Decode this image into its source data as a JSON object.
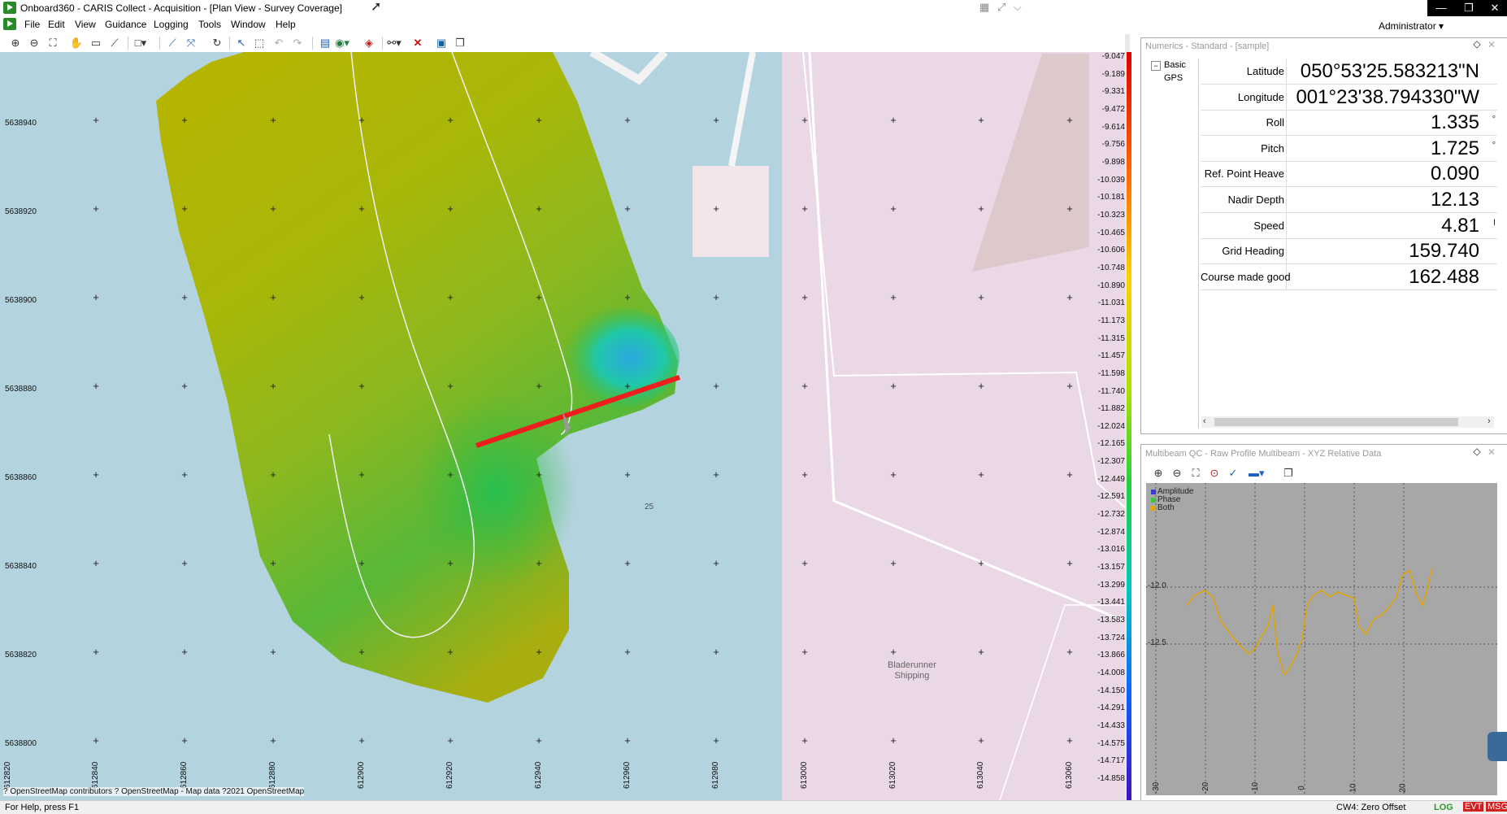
{
  "window": {
    "title": "Onboard360 - CARIS Collect - Acquisition - [Plan View - Survey Coverage]",
    "minimize_label": "—",
    "maximize_label": "❐",
    "close_label": "✕",
    "user_menu": "Administrator ▾"
  },
  "menu": {
    "items": [
      "File",
      "Edit",
      "View",
      "Guidance",
      "Logging",
      "Tools",
      "Window",
      "Help"
    ]
  },
  "plan_view": {
    "northing_labels": [
      "5638940",
      "5638920",
      "5638900",
      "5638880",
      "5638860",
      "5638840",
      "5638820",
      "5638800"
    ],
    "easting_labels": [
      "612820",
      "612840",
      "612860",
      "612880",
      "612900",
      "612920",
      "612940",
      "612960",
      "612980",
      "613000",
      "613020",
      "613040",
      "613060"
    ],
    "colorbar_labels": [
      "-9.047",
      "-9.189",
      "-9.331",
      "-9.472",
      "-9.614",
      "-9.756",
      "-9.898",
      "-10.039",
      "-10.181",
      "-10.323",
      "-10.465",
      "-10.606",
      "-10.748",
      "-10.890",
      "-11.031",
      "-11.173",
      "-11.315",
      "-11.457",
      "-11.598",
      "-11.740",
      "-11.882",
      "-12.024",
      "-12.165",
      "-12.307",
      "-12.449",
      "-12.591",
      "-12.732",
      "-12.874",
      "-13.016",
      "-13.157",
      "-13.299",
      "-13.441",
      "-13.583",
      "-13.724",
      "-13.866",
      "-14.008",
      "-14.150",
      "-14.291",
      "-14.433",
      "-14.575",
      "-14.717",
      "-14.858"
    ],
    "map_label": "Bladerunner\nShipping",
    "depth_label": "25",
    "attribution": "? OpenStreetMap contributors ? OpenStreetMap - Map data ?2021 OpenStreetMap"
  },
  "numerics": {
    "title": "Numerics - Standard - [sample]",
    "tree": [
      "Basic",
      "GPS"
    ],
    "rows": [
      {
        "label": "Latitude",
        "value": "050°53'25.583213\"N",
        "unit": ""
      },
      {
        "label": "Longitude",
        "value": "001°23'38.794330\"W",
        "unit": ""
      },
      {
        "label": "Roll",
        "value": "1.335",
        "unit": "°"
      },
      {
        "label": "Pitch",
        "value": "1.725",
        "unit": "°"
      },
      {
        "label": "Ref. Point Heave",
        "value": "0.090",
        "unit": ""
      },
      {
        "label": "Nadir Depth",
        "value": "12.13",
        "unit": ""
      },
      {
        "label": "Speed",
        "value": "4.81",
        "unit": "I"
      },
      {
        "label": "Grid Heading",
        "value": "159.740",
        "unit": ""
      },
      {
        "label": "Course made good",
        "value": "162.488",
        "unit": ""
      }
    ]
  },
  "multibeam": {
    "title": "Multibeam QC - Raw Profile Multibeam - XYZ Relative Data",
    "legend": [
      {
        "name": "Amplitude",
        "color": "#3b3bd6"
      },
      {
        "name": "Phase",
        "color": "#3cc83c"
      },
      {
        "name": "Both",
        "color": "#e0a800"
      }
    ],
    "y_ticks": [
      "-12.0",
      "-12.5"
    ],
    "x_ticks": [
      "-30",
      "-20",
      "-10",
      "0",
      "10",
      "20"
    ]
  },
  "status": {
    "help": "For Help, press F1",
    "offset": "CW4: Zero Offset",
    "log": "LOG",
    "evt": "EVT",
    "msg": "MSG"
  },
  "colors": {
    "water": "#b3d4df",
    "land": "#ead8e6",
    "profile_line": "#ee1c1c",
    "profile_curve": "#e0a400"
  }
}
